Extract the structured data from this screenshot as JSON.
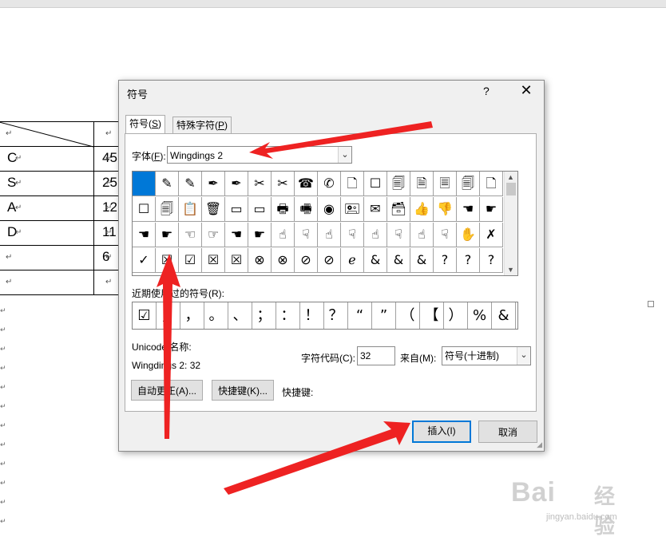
{
  "document": {
    "table_rows": [
      {
        "col0": "",
        "col1": "",
        "col2": ""
      },
      {
        "col0": "C",
        "col1": "45",
        "col2": ""
      },
      {
        "col0": "S",
        "col1": "25",
        "col2": ""
      },
      {
        "col0": "A",
        "col1": "12",
        "col2": ""
      },
      {
        "col0": "D",
        "col1": "11",
        "col2": ""
      },
      {
        "col0": "",
        "col1": "6",
        "col2": ""
      },
      {
        "col0": "",
        "col1": "",
        "col2": ""
      }
    ],
    "para_mark": "↵"
  },
  "dialog": {
    "title": "符号",
    "help": "?",
    "close": "✕",
    "tabs": [
      {
        "label": "符号(",
        "key": "S",
        "suffix": ")"
      },
      {
        "label": "特殊字符(",
        "key": "P",
        "suffix": ")"
      }
    ],
    "font_label_pre": "字体(",
    "font_label_key": "F",
    "font_label_post": "):",
    "font_value": "Wingdings 2",
    "symbols": [
      [
        "",
        "✎",
        "✎",
        "✒",
        "✒",
        "✂",
        "✂",
        "☎",
        "✆",
        "🗋",
        "☐",
        "🗐",
        "🗎",
        "🗏",
        "🗐",
        "🗋"
      ],
      [
        "☐",
        "🗐",
        "📋",
        "🗑",
        "▭",
        "▭",
        "🖶",
        "🖷",
        "◉",
        "🖭",
        "✉",
        "🗃",
        "👍",
        "👎",
        "☚",
        "☛"
      ],
      [
        "☚",
        "☛",
        "☜",
        "☞",
        "☚",
        "☛",
        "☝",
        "☟",
        "☝",
        "☟",
        "☝",
        "☟",
        "☝",
        "☟",
        "✋",
        "✗"
      ],
      [
        "✓",
        "☒",
        "☑",
        "☒",
        "☒",
        "⊗",
        "⊗",
        "⊘",
        "⊘",
        "ℯ",
        "&",
        "&",
        "&",
        "?",
        "?",
        "?"
      ]
    ],
    "recent_label": "近期使用过的符号(R):",
    "recent_symbols": [
      "☑",
      "，",
      "，",
      "。",
      "、",
      "；",
      "：",
      "！",
      "？",
      "“",
      "”",
      "（",
      "【",
      "）",
      "%",
      "&"
    ],
    "unicode_label": "Unicode 名称:",
    "char_name": "Wingdings 2: 32",
    "char_code_label": "字符代码(C):",
    "char_code_value": "32",
    "from_label": "来自(M):",
    "from_value": "符号(十进制)",
    "autocorrect_button": "自动更正(A)...",
    "shortcut_button": "快捷键(K)...",
    "shortcut_label": "快捷键:",
    "insert_button": "插入(I)",
    "cancel_button": "取消"
  },
  "watermark": {
    "brand": "Bai",
    "cn": "经验",
    "url": "jingyan.baidu.com"
  },
  "colors": {
    "selected_cell": "#0078d7",
    "arrow_red": "#ee2222"
  }
}
